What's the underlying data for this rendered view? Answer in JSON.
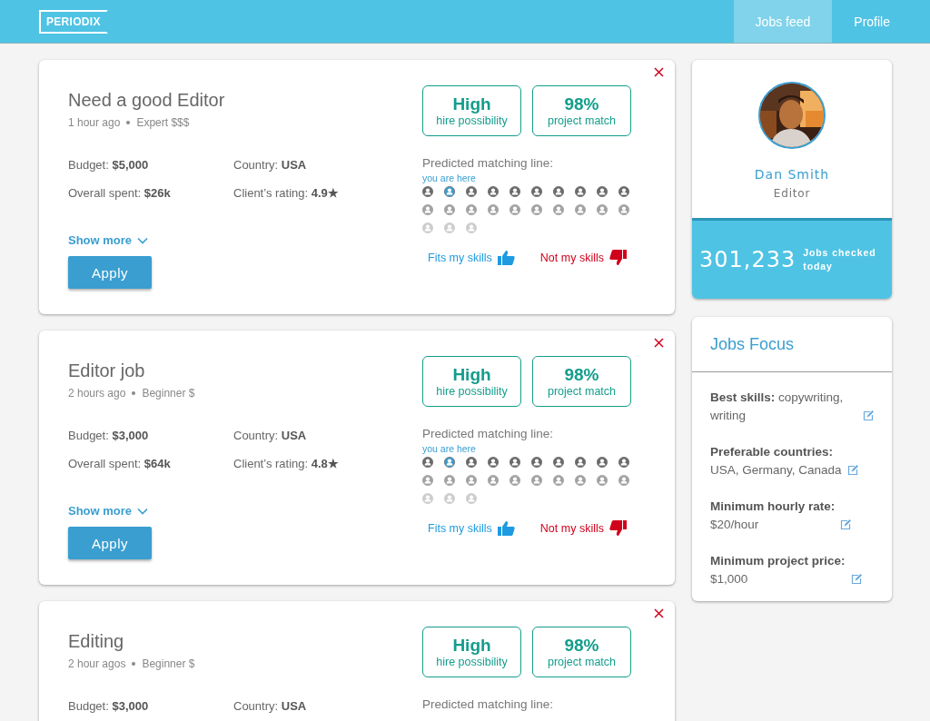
{
  "header": {
    "logo": "PERIODIX",
    "nav": [
      {
        "label": "Jobs feed",
        "selected": true
      },
      {
        "label": "Profile",
        "selected": false
      }
    ]
  },
  "jobs": [
    {
      "title": "Need a good Editor",
      "time": "1 hour ago",
      "level": "Expert $$$",
      "badges": [
        {
          "value": "High",
          "caption": "hire possibility"
        },
        {
          "value": "98%",
          "caption": "project match"
        }
      ],
      "details": [
        "Budget: **$5,000**",
        "Country: **USA**",
        "Overall spent: **$26k**",
        "Client’s rating: **4.9★**"
      ],
      "show_more": "Show more",
      "apply": "Apply",
      "matching": {
        "caption": "Predicted matching line:",
        "marker": "you are here",
        "people": [
          {
            "kind": "dark",
            "selected": false
          },
          {
            "kind": "dark",
            "selected": true
          },
          {
            "kind": "dark",
            "selected": false
          },
          {
            "kind": "dark",
            "selected": false
          },
          {
            "kind": "dark",
            "selected": false
          },
          {
            "kind": "dark",
            "selected": false
          },
          {
            "kind": "dark",
            "selected": false
          },
          {
            "kind": "dark",
            "selected": false
          },
          {
            "kind": "dark",
            "selected": false
          },
          {
            "kind": "dark",
            "selected": false
          },
          {
            "kind": "mid",
            "selected": false
          },
          {
            "kind": "mid",
            "selected": false
          },
          {
            "kind": "mid",
            "selected": false
          },
          {
            "kind": "mid",
            "selected": false
          },
          {
            "kind": "mid",
            "selected": false
          },
          {
            "kind": "mid",
            "selected": false
          },
          {
            "kind": "mid",
            "selected": false
          },
          {
            "kind": "mid",
            "selected": false
          },
          {
            "kind": "mid",
            "selected": false
          },
          {
            "kind": "mid",
            "selected": false
          },
          {
            "kind": "light",
            "selected": false
          },
          {
            "kind": "light",
            "selected": false
          },
          {
            "kind": "light",
            "selected": false
          }
        ]
      },
      "fits": "Fits my skills",
      "not_fits": "Not my skills"
    },
    {
      "title": "Editor job",
      "time": "2 hours ago",
      "level": "Beginner $",
      "badges": [
        {
          "value": "High",
          "caption": "hire possibility"
        },
        {
          "value": "98%",
          "caption": "project match"
        }
      ],
      "details": [
        "Budget: **$3,000**",
        "Country: **USA**",
        "Overall spent: **$64k**",
        "Client’s rating: **4.8★**"
      ],
      "show_more": "Show more",
      "apply": "Apply",
      "matching": {
        "caption": "Predicted matching line:",
        "marker": "you are here",
        "people": [
          {
            "kind": "dark",
            "selected": false
          },
          {
            "kind": "dark",
            "selected": true
          },
          {
            "kind": "dark",
            "selected": false
          },
          {
            "kind": "dark",
            "selected": false
          },
          {
            "kind": "dark",
            "selected": false
          },
          {
            "kind": "dark",
            "selected": false
          },
          {
            "kind": "dark",
            "selected": false
          },
          {
            "kind": "dark",
            "selected": false
          },
          {
            "kind": "dark",
            "selected": false
          },
          {
            "kind": "dark",
            "selected": false
          },
          {
            "kind": "mid",
            "selected": false
          },
          {
            "kind": "mid",
            "selected": false
          },
          {
            "kind": "mid",
            "selected": false
          },
          {
            "kind": "mid",
            "selected": false
          },
          {
            "kind": "mid",
            "selected": false
          },
          {
            "kind": "mid",
            "selected": false
          },
          {
            "kind": "mid",
            "selected": false
          },
          {
            "kind": "mid",
            "selected": false
          },
          {
            "kind": "mid",
            "selected": false
          },
          {
            "kind": "mid",
            "selected": false
          },
          {
            "kind": "light",
            "selected": false
          },
          {
            "kind": "light",
            "selected": false
          },
          {
            "kind": "light",
            "selected": false
          }
        ]
      },
      "fits": "Fits my skills",
      "not_fits": "Not my skills"
    },
    {
      "title": "Editing",
      "time": "2 hour agos",
      "level": "Beginner $",
      "badges": [
        {
          "value": "High",
          "caption": "hire possibility"
        },
        {
          "value": "98%",
          "caption": "project match"
        }
      ],
      "details": [
        "Budget: **$3,000**",
        "Country: **USA**"
      ],
      "matching": {
        "caption": "Predicted matching line:"
      }
    }
  ],
  "profile": {
    "name": "Dan Smith",
    "role": "Editor",
    "count": "301,233",
    "count_label": "Jobs checked today"
  },
  "focus": {
    "title": "Jobs Focus",
    "items": [
      {
        "kind": "inline",
        "label": "Best skills:",
        "value": "copywriting, writing"
      },
      {
        "kind": "stacked",
        "label": "Preferable countries:",
        "value": "USA, Germany, Canada"
      },
      {
        "kind": "stacked",
        "label": "Minimum hourly rate:",
        "value": "$20/hour"
      },
      {
        "kind": "stacked",
        "label": "Minimum project price:",
        "value": "$1,000"
      }
    ]
  }
}
